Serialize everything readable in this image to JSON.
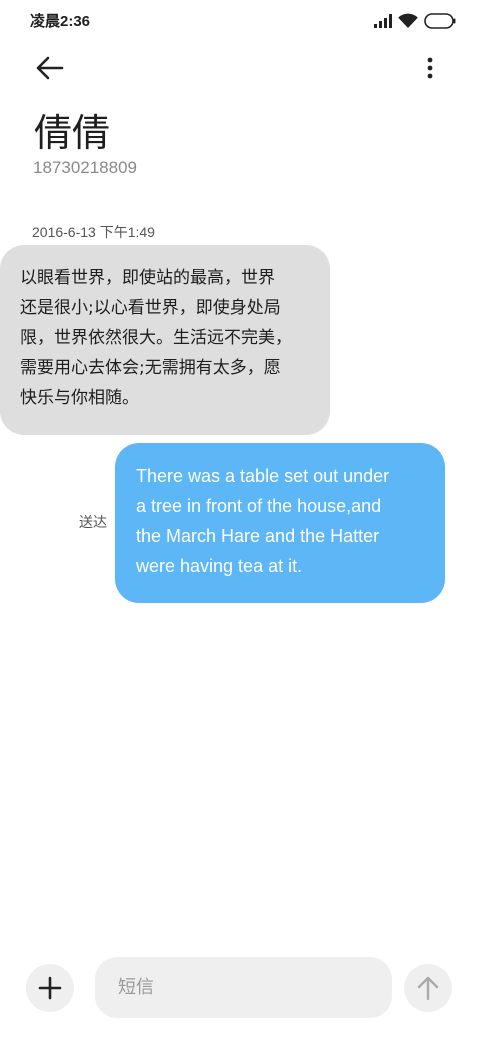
{
  "status_bar": {
    "time": "凌晨2:36",
    "icons": [
      "signal-icon",
      "wifi-icon",
      "battery-icon"
    ]
  },
  "header": {
    "back_icon": "back-arrow-icon",
    "menu_icon": "more-vertical-icon"
  },
  "contact": {
    "name": "倩倩",
    "phone": "18730218809"
  },
  "thread": {
    "timestamp": "2016-6-13 下午1:49",
    "received_message": {
      "lines": [
        "以眼看世界，即使站的最高，世界",
        "还是很小;以心看世界，即使身处局",
        "限，世界依然很大。生活远不完美，",
        "需要用心去体会;无需拥有太多，愿",
        "快乐与你相随。"
      ]
    },
    "sent_message": {
      "status": "送达",
      "lines": [
        "There was a table set out under",
        "a tree in front of the house,and",
        "the March Hare and the Hatter",
        "were having tea at it."
      ]
    }
  },
  "composer": {
    "add_icon": "plus-icon",
    "placeholder": "短信",
    "send_icon": "arrow-up-icon"
  },
  "colors": {
    "received_bubble": "#dedede",
    "sent_bubble": "#5db6f6",
    "sent_text": "#ffffff",
    "composer_bg": "#efefef"
  }
}
